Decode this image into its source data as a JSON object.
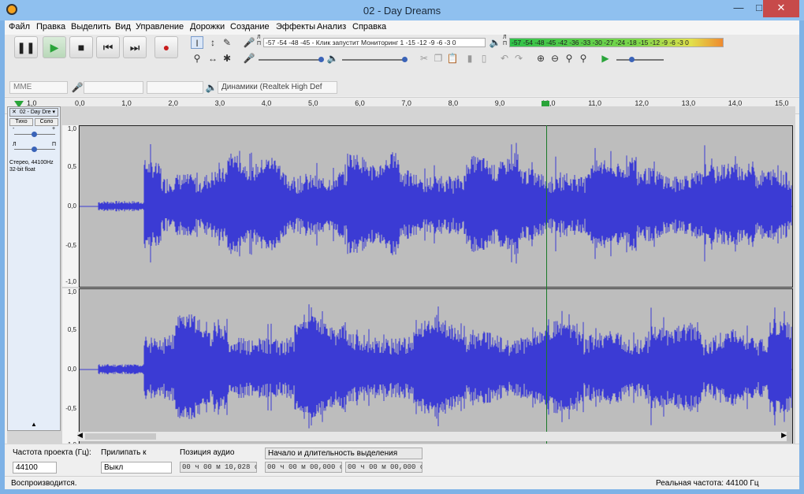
{
  "window": {
    "title": "02 - Day Dreams"
  },
  "menu": [
    "Файл",
    "Правка",
    "Выделить",
    "Вид",
    "Управление",
    "Дорожки",
    "Создание",
    "Эффекты",
    "Анализ",
    "Справка"
  ],
  "meters": {
    "rec_scale": "-57 -54    -48 -45 - Клик запустит Мониторинг 1 -15 -12  -9  -6  -3  0",
    "play_scale": "-57 -54    -48 -45 -42    -36 -33 -30 -27 -24    -18 -15 -12  -9  -6  -3  0",
    "rec_lr": "Л\nП",
    "play_lr": "Л\nП"
  },
  "device": {
    "host": "MME",
    "output": "Динамики (Realtek High Def"
  },
  "ruler": {
    "ticks": [
      "1,0",
      "0,0",
      "1,0",
      "2,0",
      "3,0",
      "4,0",
      "5,0",
      "6,0",
      "7,0",
      "8,0",
      "9,0",
      "10,0",
      "11,0",
      "12,0",
      "13,0",
      "14,0",
      "15,0"
    ]
  },
  "track": {
    "name": "02 - Day Dre",
    "mute": "Тихо",
    "solo": "Соло",
    "info": "Стерео, 44100Hz\n32-bit float",
    "gain_minus": "-",
    "gain_plus": "+",
    "pan_l": "Л",
    "pan_r": "П"
  },
  "scale": {
    "top": "1,0",
    "half": "0,5",
    "zero": "0,0",
    "nhalf": "-0,5",
    "bottom": "-1,0"
  },
  "selection_bar": {
    "rate_label": "Частота проекта (Гц):",
    "rate_value": "44100",
    "snap_label": "Прилипать к",
    "snap_value": "Выкл",
    "pos_label": "Позиция аудио",
    "pos_value": "00 ч 00 м 10,028 с",
    "sel_label": "Начало и длительность выделения",
    "sel_start": "00 ч 00 м 00,000 с",
    "sel_len": "00 ч 00 м 00,000 с"
  },
  "status": {
    "left": "Воспроизводится.",
    "right": "Реальная частота: 44100 Гц"
  },
  "colors": {
    "wave": "#3b3bd4",
    "selection": "#bdbdbd"
  }
}
